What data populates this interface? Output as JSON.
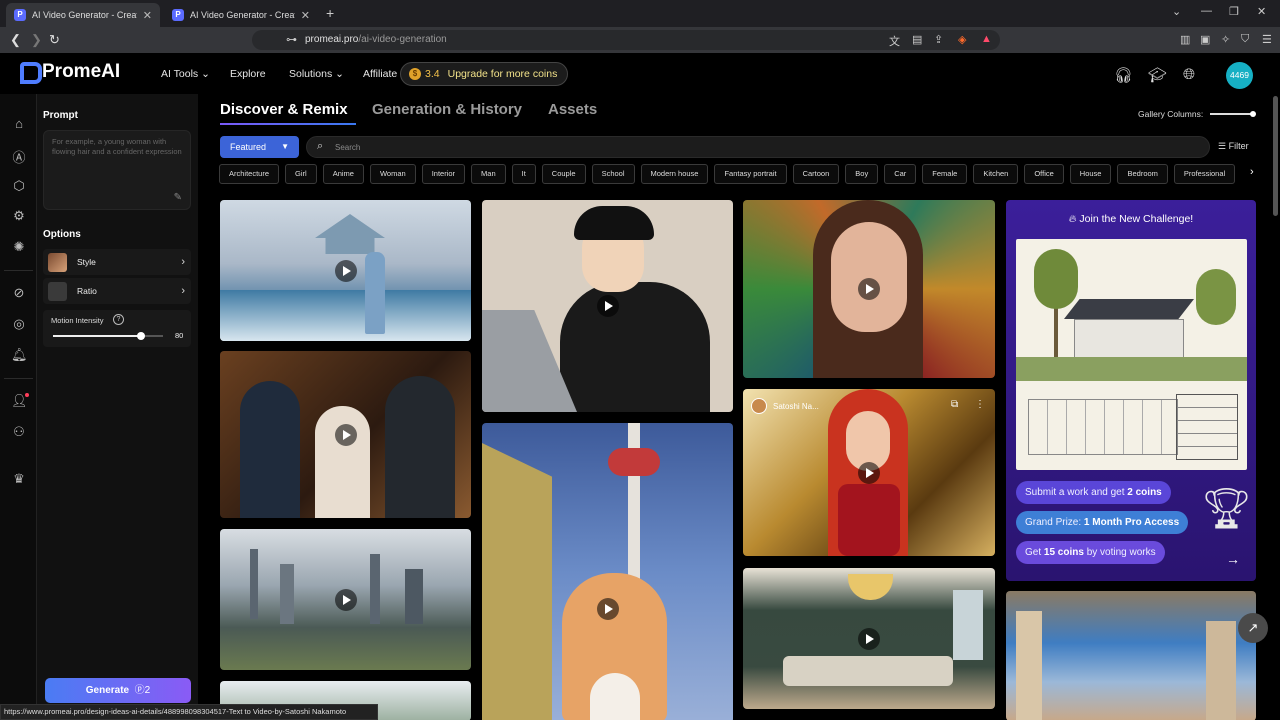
{
  "browser": {
    "tabs": [
      {
        "title": "AI Video Generator - Create AI",
        "active": true
      },
      {
        "title": "AI Video Generator - Create AI Vide",
        "active": false
      }
    ],
    "url_host": "promeai.pro",
    "url_path": "/ai-video-generation"
  },
  "header": {
    "logo": "PromeAI",
    "nav": [
      "AI Tools",
      "Explore",
      "Solutions",
      "Affiliate"
    ],
    "coins_value": "3.4",
    "coins_cta": "Upgrade for more coins",
    "avatar_text": "4469"
  },
  "panel": {
    "prompt_label": "Prompt",
    "prompt_placeholder": "For example, a young woman with flowing hair and a confident expression",
    "options_label": "Options",
    "style_label": "Style",
    "ratio_label": "Ratio",
    "motion_label": "Motion Intensity",
    "motion_value": "80",
    "motion_fraction": 0.8,
    "generate_label": "Generate",
    "generate_cost": "2"
  },
  "main": {
    "tabs": [
      "Discover & Remix",
      "Generation & History",
      "Assets"
    ],
    "gallery_columns_label": "Gallery Columns:",
    "featured_label": "Featured",
    "search_placeholder": "Search",
    "filter_label": "Filter",
    "chips": [
      "Architecture",
      "Girl",
      "Anime",
      "Woman",
      "Interior",
      "Man",
      "It",
      "Couple",
      "School",
      "Modern house",
      "Fantasy portrait",
      "Cartoon",
      "Boy",
      "Car",
      "Female",
      "Kitchen",
      "Office",
      "House",
      "Bedroom",
      "Professional"
    ]
  },
  "gallery": {
    "creator_name": "Satoshi Na...",
    "challenge": {
      "title": "Join the New Challenge!",
      "pill1_prefix": "Submit a work and get ",
      "pill1_bold": "2 coins",
      "pill2_prefix": "Grand Prize: ",
      "pill2_bold": "1 Month Pro Access",
      "pill3_prefix": "Get ",
      "pill3_bold": "15 coins",
      "pill3_suffix": " by voting works"
    }
  },
  "status_url": "https://www.promeai.pro/design-ideas-ai-details/488998098304517-Text to Video-by-Satoshi Nakamoto",
  "colors": {
    "brand": "#4f7dff",
    "generate_gradient_start": "#4a7cf3",
    "generate_gradient_end": "#8a5bf5",
    "challenge_bg": "#3b1f9a",
    "avatar": "#16b0c4"
  }
}
